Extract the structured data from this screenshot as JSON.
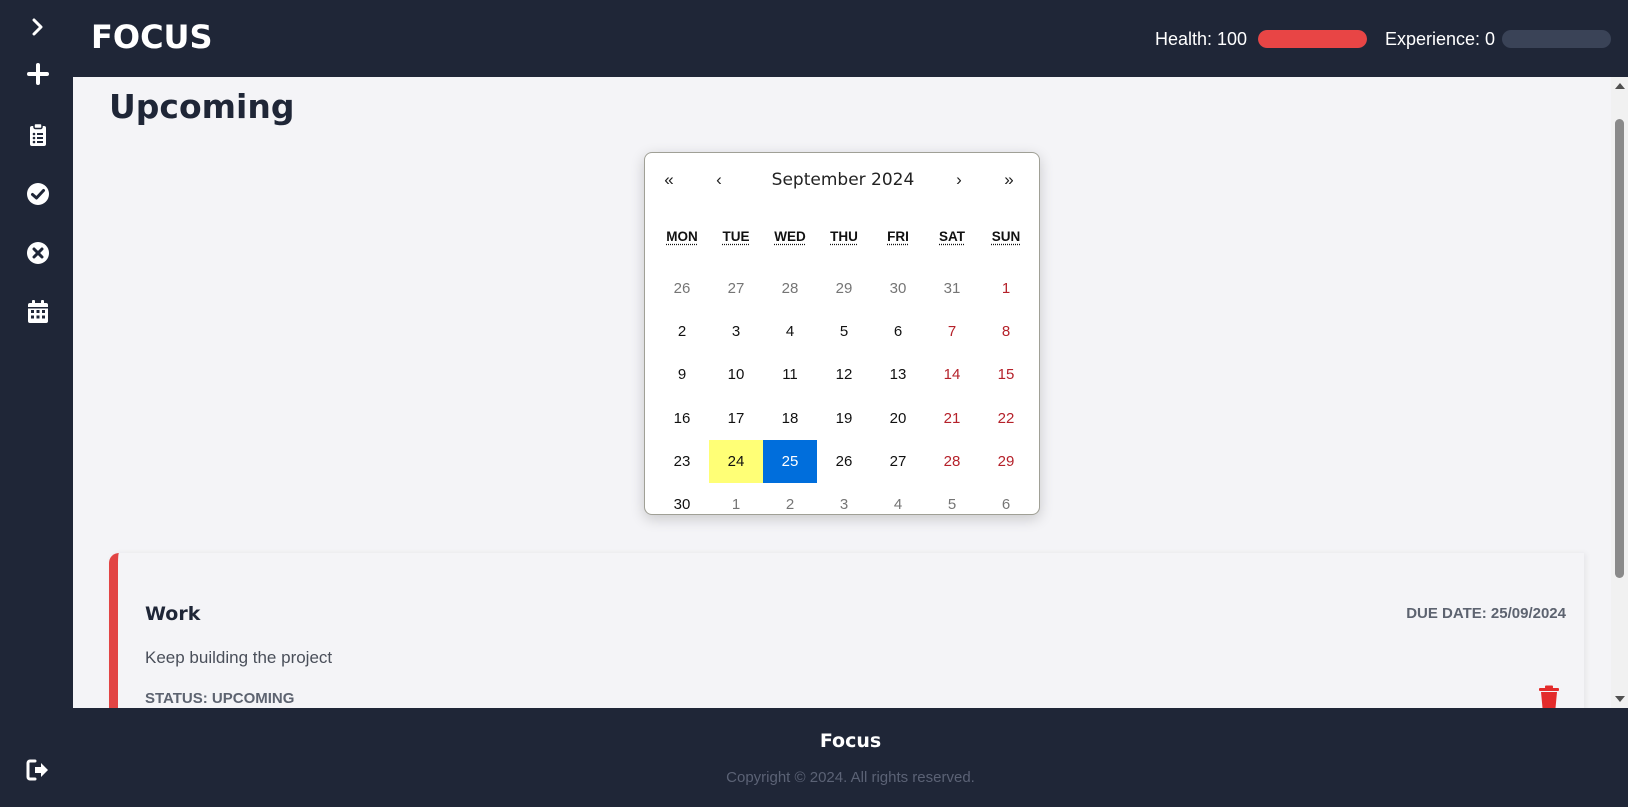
{
  "app": {
    "title": "FOCUS"
  },
  "sidebar": {
    "items": [
      {
        "icon": "chevron-right-icon"
      },
      {
        "icon": "plus-icon"
      },
      {
        "icon": "clipboard-list-icon"
      },
      {
        "icon": "check-circle-icon"
      },
      {
        "icon": "x-circle-icon"
      },
      {
        "icon": "calendar-icon"
      },
      {
        "icon": "sign-out-icon"
      }
    ]
  },
  "header": {
    "health_label": "Health: 100",
    "health_value": 100,
    "health_color": "#e84545",
    "experience_label": "Experience: 0",
    "experience_value": 0
  },
  "page": {
    "title": "Upcoming"
  },
  "calendar": {
    "prev2": "«",
    "prev": "‹",
    "month_label": "September 2024",
    "next": "›",
    "next2": "»",
    "weekdays": [
      "MON",
      "TUE",
      "WED",
      "THU",
      "FRI",
      "SAT",
      "SUN"
    ],
    "weeks": [
      [
        "26",
        "27",
        "28",
        "29",
        "30",
        "31",
        "1"
      ],
      [
        "2",
        "3",
        "4",
        "5",
        "6",
        "7",
        "8"
      ],
      [
        "9",
        "10",
        "11",
        "12",
        "13",
        "14",
        "15"
      ],
      [
        "16",
        "17",
        "18",
        "19",
        "20",
        "21",
        "22"
      ],
      [
        "23",
        "24",
        "25",
        "26",
        "27",
        "28",
        "29"
      ],
      [
        "30",
        "1",
        "2",
        "3",
        "4",
        "5",
        "6"
      ]
    ],
    "today": "24",
    "selected": "25",
    "accent_color": "#006edc",
    "today_color": "#ffff76",
    "weekend_color": "#b5212a"
  },
  "task": {
    "title": "Work",
    "due_date": "DUE DATE: 25/09/2024",
    "description": "Keep building the project",
    "status": "STATUS: UPCOMING",
    "accent_color": "#e24444",
    "delete_icon": "trash-icon"
  },
  "footer": {
    "title": "Focus",
    "copyright": "Copyright © 2024. All rights reserved."
  }
}
